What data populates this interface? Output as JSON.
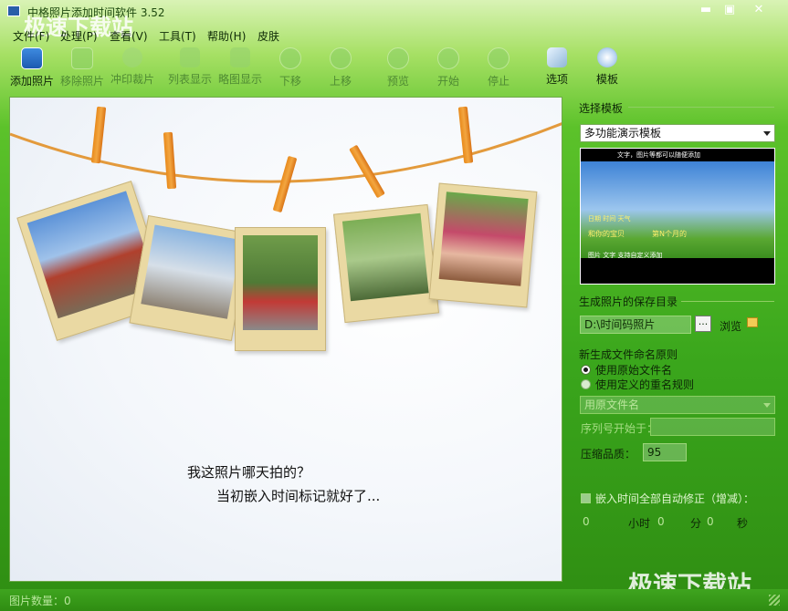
{
  "window": {
    "title": "中格照片添加时间软件 3.52",
    "minimize": "▬",
    "maximize": "▣",
    "close": "✕"
  },
  "watermark_top": "极速下载站",
  "watermark_bottom": "极速下载站",
  "menu": [
    "文件(F)",
    "处理(P)",
    "查看(V)",
    "工具(T)",
    "帮助(H)",
    "皮肤"
  ],
  "toolbar": [
    {
      "label": "添加照片",
      "icon": "add-photo-icon",
      "enabled": true
    },
    {
      "label": "移除照片",
      "icon": "remove-photo-icon",
      "enabled": false
    },
    {
      "label": "冲印裁片",
      "icon": "crop-icon",
      "enabled": false
    },
    {
      "label": "列表显示",
      "icon": "list-view-icon",
      "enabled": false
    },
    {
      "label": "略图显示",
      "icon": "thumbnail-view-icon",
      "enabled": false
    },
    {
      "label": "下移",
      "icon": "move-down-icon",
      "enabled": false
    },
    {
      "label": "上移",
      "icon": "move-up-icon",
      "enabled": false
    },
    {
      "label": "预览",
      "icon": "preview-icon",
      "enabled": false
    },
    {
      "label": "开始",
      "icon": "start-icon",
      "enabled": false
    },
    {
      "label": "停止",
      "icon": "stop-icon",
      "enabled": false
    },
    {
      "label": "选项",
      "icon": "options-icon",
      "enabled": true
    },
    {
      "label": "模板",
      "icon": "template-icon",
      "enabled": true
    }
  ],
  "preview": {
    "caption_line1": "我这照片哪天拍的？",
    "caption_line2": "当初嵌入时间标记就好了..."
  },
  "template_section": {
    "heading": "选择模板",
    "selected": "多功能演示模板",
    "thumb_text1": "文字，图片等都可以随便添加",
    "thumb_text2": "日期 时间 天气",
    "thumb_text3": "和你的宝贝",
    "thumb_text4": "第N个月的",
    "thumb_text5": "图片 文字 支持自定义添加"
  },
  "save_section": {
    "heading": "生成照片的保存目录",
    "path": "D:\\时间码照片",
    "ellipsis": "...",
    "browse": "浏览"
  },
  "naming_section": {
    "heading": "新生成文件命名原则",
    "option1": "使用原始文件名",
    "option2": "使用定义的重名规则",
    "rule_combo": "用原文件名",
    "serial_label": "序列号开始于：",
    "quality_label": "压缩品质：",
    "quality_value": "95"
  },
  "time_section": {
    "checkbox_label": "嵌入时间全部自动修正（增减）：",
    "hours_value": "0",
    "hours_unit": "小时",
    "minutes_value": "0",
    "minutes_unit": "分",
    "seconds_value": "0",
    "seconds_unit": "秒"
  },
  "status": {
    "text": "图片数量：0"
  },
  "colors": {
    "accent_green": "#3aa61c",
    "panel_border": "#6fa84a",
    "clip_orange": "#e88a1c",
    "photo_frame": "#ead9a3"
  }
}
